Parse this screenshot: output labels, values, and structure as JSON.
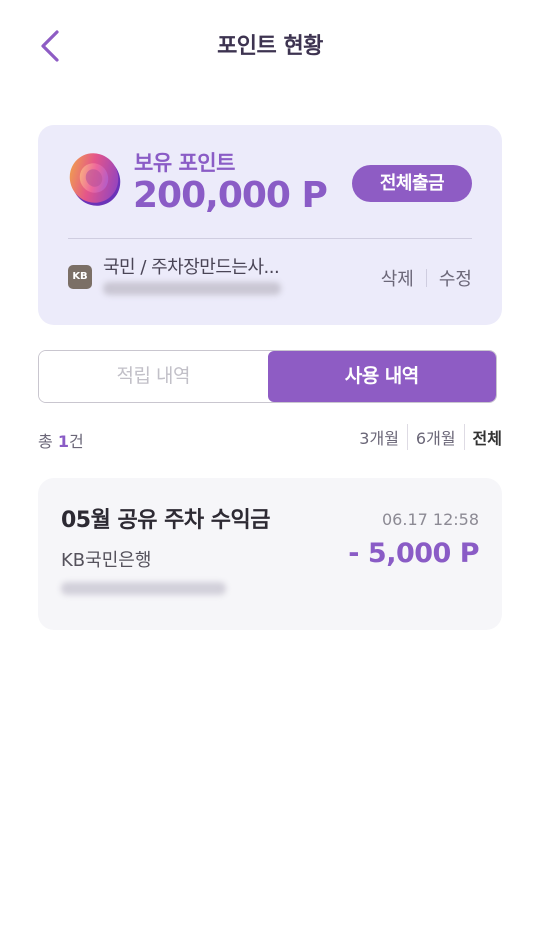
{
  "header": {
    "title": "포인트 현황",
    "back_icon": "chevron-left-icon"
  },
  "point_card": {
    "label": "보유 포인트",
    "amount": "200,000 P",
    "withdraw_label": "전체출금",
    "coin_icon": "coin-icon",
    "account": {
      "bank_logo_text": "KB",
      "name": "국민 / 주차장만드는사...",
      "number_blurred": true
    },
    "actions": {
      "delete_label": "삭제",
      "edit_label": "수정"
    }
  },
  "tabs": [
    {
      "label": "적립 내역",
      "active": false
    },
    {
      "label": "사용 내역",
      "active": true
    }
  ],
  "summary": {
    "prefix": "총 ",
    "count": "1",
    "suffix": "건"
  },
  "period_filter": {
    "options": [
      "3개월",
      "6개월",
      "전체"
    ],
    "selected": "전체"
  },
  "transactions": [
    {
      "title": "05월 공유 주차 수익금",
      "datetime": "06.17 12:58",
      "bank": "KB국민은행",
      "amount": "- 5,000 P",
      "account_blurred": true
    }
  ],
  "colors": {
    "accent": "#8e5cc4",
    "card_bg": "#ecebfa",
    "tx_bg": "#f6f6f9"
  }
}
